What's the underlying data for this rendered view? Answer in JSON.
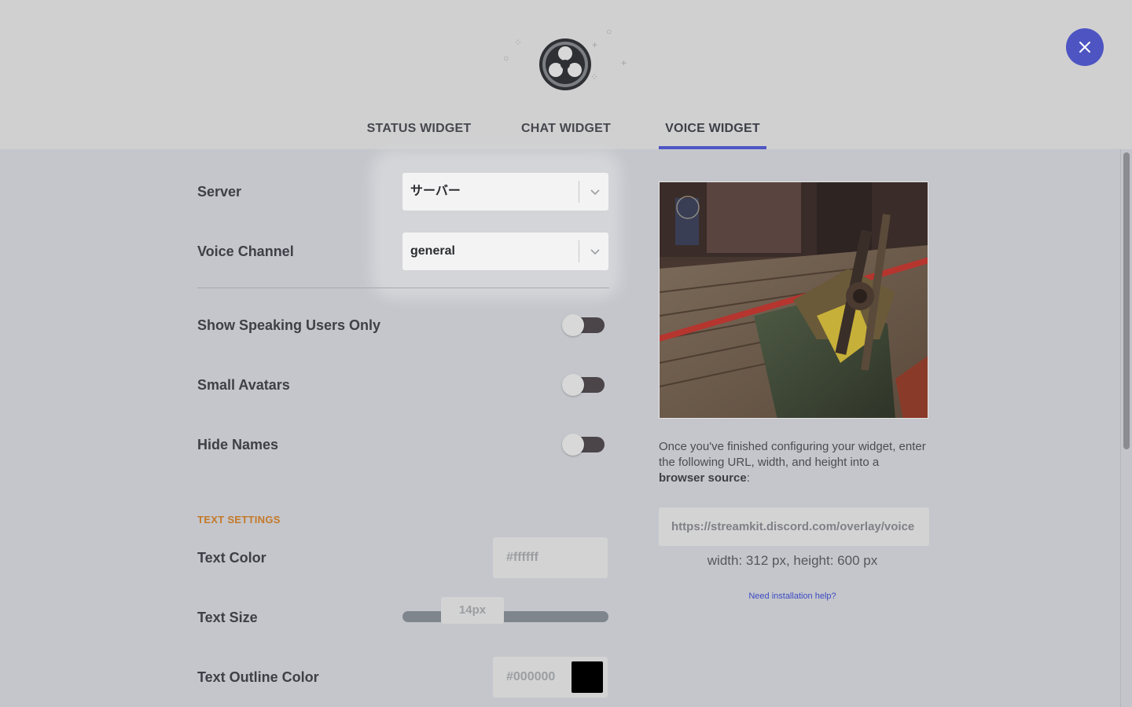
{
  "header": {
    "tabs": [
      {
        "label": "STATUS WIDGET",
        "active": false
      },
      {
        "label": "CHAT WIDGET",
        "active": false
      },
      {
        "label": "VOICE WIDGET",
        "active": true
      }
    ],
    "close_icon": "close-icon",
    "logo_icon": "obs-logo-icon"
  },
  "settings": {
    "server": {
      "label": "Server",
      "value": "サーバー"
    },
    "voice_channel": {
      "label": "Voice Channel",
      "value": "general"
    },
    "toggles": [
      {
        "label": "Show Speaking Users Only",
        "on": false
      },
      {
        "label": "Small Avatars",
        "on": false
      },
      {
        "label": "Hide Names",
        "on": false
      }
    ],
    "text_settings": {
      "section_title": "TEXT SETTINGS",
      "text_color": {
        "label": "Text Color",
        "value": "#ffffff"
      },
      "text_size": {
        "label": "Text Size",
        "value": "14px"
      },
      "text_outline_color": {
        "label": "Text Outline Color",
        "value": "#000000",
        "swatch": "#000000"
      }
    }
  },
  "preview": {
    "instructions_pre": "Once you've finished configuring your widget, enter the following URL, width, and height into a ",
    "instructions_bold": "browser source",
    "instructions_post": ":",
    "url": "https://streamkit.discord.com/overlay/voice",
    "dimensions": "width: 312 px, height: 600 px",
    "help_link": "Need installation help?"
  },
  "colors": {
    "accent": "#4f56c4",
    "section_title": "#c4792a",
    "link": "#3d4ac2"
  }
}
